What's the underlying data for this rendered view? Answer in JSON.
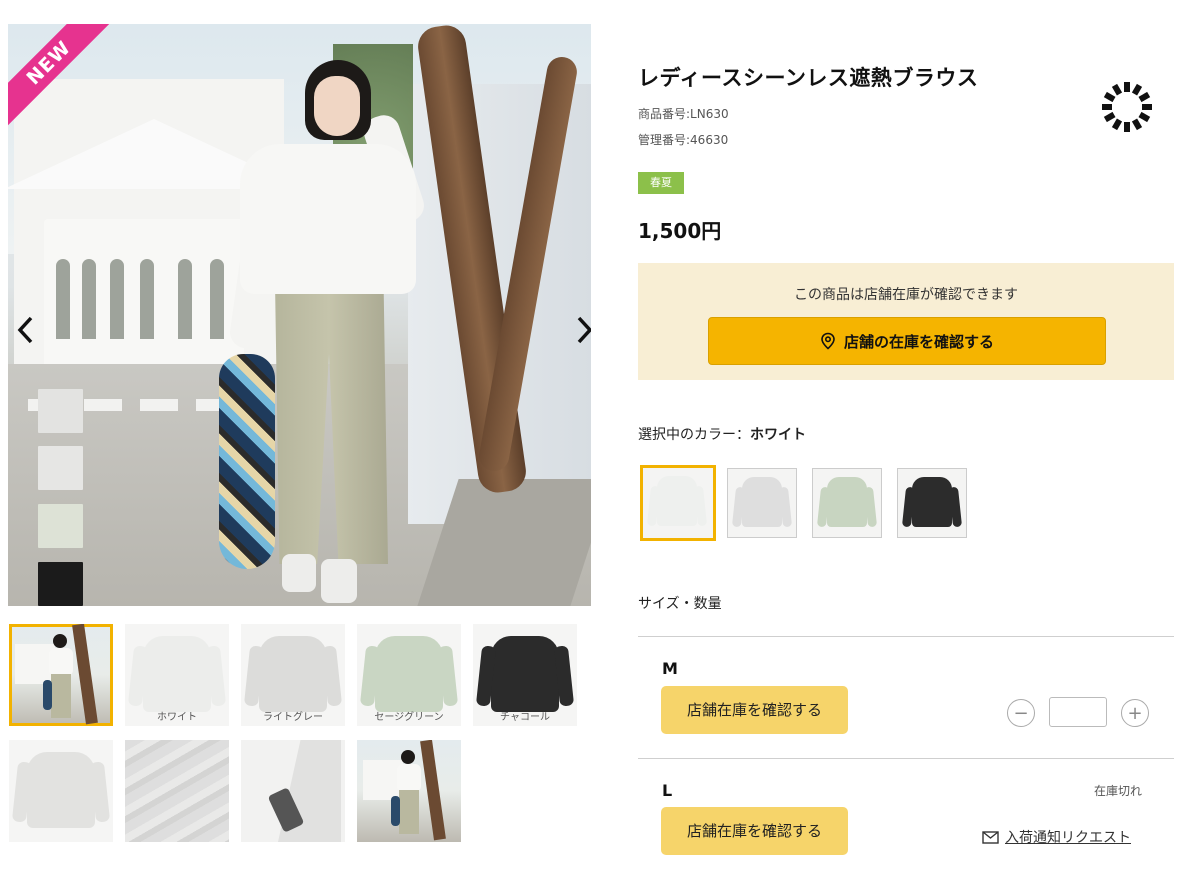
{
  "gallery": {
    "badge": "NEW",
    "prev_icon": "chevron-left-icon",
    "next_icon": "chevron-right-icon",
    "swatch_colors": [
      "#e3e3e1",
      "#e6e6e4",
      "#dde2d6",
      "#1b1b1b"
    ],
    "thumbnails": [
      {
        "label": "",
        "kind": "photo"
      },
      {
        "label": "ホワイト",
        "color": "#ecedeb"
      },
      {
        "label": "ライトグレー",
        "color": "#dcdcda"
      },
      {
        "label": "セージグリーン",
        "color": "#c9d6c3"
      },
      {
        "label": "チャコール",
        "color": "#2b2b2b"
      },
      {
        "label": "",
        "color": "#e2e2e0"
      },
      {
        "label": "",
        "kind": "fabric"
      },
      {
        "label": "",
        "kind": "detail"
      },
      {
        "label": "",
        "kind": "photo"
      }
    ]
  },
  "product": {
    "title": "レディースシーンレス遮熱ブラウス",
    "product_number": "商品番号:LN630",
    "management_number": "管理番号:46630",
    "season": "春夏",
    "price": "1,500円",
    "loading_icon": "loading-spinner-icon"
  },
  "store_stock": {
    "message": "この商品は店舗在庫が確認できます",
    "button_label": "店舗の在庫を確認する",
    "button_icon": "location-pin-icon"
  },
  "color": {
    "label": "選択中のカラー：",
    "selected": "ホワイト",
    "options": [
      {
        "name": "ホワイト",
        "color": "#eef0ee"
      },
      {
        "name": "ライトグレー",
        "color": "#dedede"
      },
      {
        "name": "セージグリーン",
        "color": "#c8d5c1"
      },
      {
        "name": "チャコール",
        "color": "#2c2c2c"
      }
    ]
  },
  "sizes": {
    "heading": "サイズ・数量",
    "items": [
      {
        "name": "M",
        "button_label": "店舗在庫を確認する",
        "minus": "−",
        "plus": "+",
        "quantity": ""
      },
      {
        "name": "L",
        "button_label": "店舗在庫を確認する",
        "status": "在庫切れ",
        "notify_label": "入荷通知リクエスト",
        "notify_icon": "mail-icon"
      }
    ]
  },
  "colors": {
    "accent": "#f5b400",
    "season_tag": "#8cc04a",
    "new_badge": "#e6338f",
    "stock_bg": "#f8eed4",
    "size_button": "#f6d46a"
  }
}
